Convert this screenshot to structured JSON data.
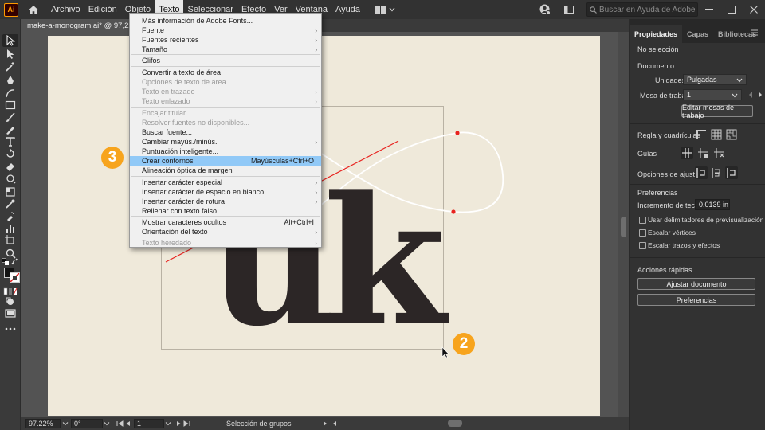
{
  "app": {
    "logo": "Ai"
  },
  "menubar": {
    "items": [
      "Archivo",
      "Edición",
      "Objeto",
      "Texto",
      "Seleccionar",
      "Efecto",
      "Ver",
      "Ventana",
      "Ayuda"
    ],
    "active_index": 3,
    "search_placeholder": "Buscar en Ayuda de Adobe"
  },
  "document": {
    "tab_title": "make-a-monogram.ai* @ 97,22 % (RGB/Previsualizar)",
    "letters": "uk"
  },
  "text_menu": {
    "items": [
      {
        "label": "Más información de Adobe Fonts...",
        "enabled": true,
        "submenu": false
      },
      {
        "label": "Fuente",
        "enabled": true,
        "submenu": true
      },
      {
        "label": "Fuentes recientes",
        "enabled": true,
        "submenu": true
      },
      {
        "label": "Tamaño",
        "enabled": true,
        "submenu": true
      },
      {
        "label": "Glifos",
        "enabled": true,
        "submenu": false
      },
      {
        "label": "Convertir a texto de área",
        "enabled": true,
        "submenu": false
      },
      {
        "label": "Opciones de texto de área...",
        "enabled": false,
        "submenu": false
      },
      {
        "label": "Texto en trazado",
        "enabled": false,
        "submenu": true
      },
      {
        "label": "Texto enlazado",
        "enabled": false,
        "submenu": true
      },
      {
        "label": "Encajar titular",
        "enabled": false,
        "submenu": false
      },
      {
        "label": "Resolver fuentes no disponibles...",
        "enabled": false,
        "submenu": false
      },
      {
        "label": "Buscar fuente...",
        "enabled": true,
        "submenu": false
      },
      {
        "label": "Cambiar mayús./minús.",
        "enabled": true,
        "submenu": true
      },
      {
        "label": "Puntuación inteligente...",
        "enabled": true,
        "submenu": false
      },
      {
        "label": "Crear contornos",
        "enabled": true,
        "submenu": false,
        "shortcut": "Mayúsculas+Ctrl+O",
        "highlighted": true
      },
      {
        "label": "Alineación óptica de margen",
        "enabled": true,
        "submenu": false
      },
      {
        "label": "Insertar carácter especial",
        "enabled": true,
        "submenu": true
      },
      {
        "label": "Insertar carácter de espacio en blanco",
        "enabled": true,
        "submenu": true
      },
      {
        "label": "Insertar carácter de rotura",
        "enabled": true,
        "submenu": true
      },
      {
        "label": "Rellenar con texto falso",
        "enabled": true,
        "submenu": false
      },
      {
        "label": "Mostrar caracteres ocultos",
        "enabled": true,
        "submenu": false,
        "shortcut": "Alt+Ctrl+I"
      },
      {
        "label": "Orientación del texto",
        "enabled": true,
        "submenu": true
      },
      {
        "label": "Texto heredado",
        "enabled": false,
        "submenu": true
      }
    ]
  },
  "badges": {
    "step3": "3",
    "step2": "2"
  },
  "panel": {
    "tabs": [
      "Propiedades",
      "Capas",
      "Bibliotecas"
    ],
    "active_tab": 0,
    "no_selection": "No selección",
    "document_heading": "Documento",
    "units_label": "Unidades:",
    "units_value": "Pulgadas",
    "artboard_label": "Mesa de trabajo:",
    "artboard_value": "1",
    "edit_artboards_button": "Editar mesas de trabajo",
    "rulers_label": "Regla y cuadrículas",
    "guides_label": "Guías",
    "snap_label": "Opciones de ajuste",
    "preferences_heading": "Preferencias",
    "keyboard_increment_label": "Incremento de teclado:",
    "keyboard_increment_value": "0.0139 in",
    "checkboxes": [
      "Usar delimitadores de previsualización",
      "Escalar vértices",
      "Escalar trazos y efectos"
    ],
    "quick_actions_heading": "Acciones rápidas",
    "fit_document_button": "Ajustar documento",
    "preferences_button": "Preferencias"
  },
  "statusbar": {
    "zoom": "97.22%",
    "rotation": "0°",
    "artboard": "1",
    "status": "Selección de grupos"
  },
  "colors": {
    "accent": "#f7a41d",
    "highlight": "#91c9f7",
    "artboard": "#efe9da",
    "anchor": "#e8231f"
  }
}
